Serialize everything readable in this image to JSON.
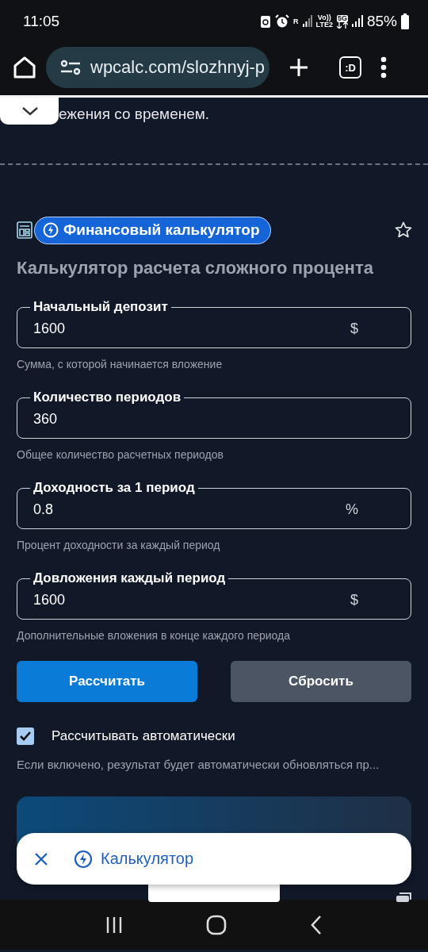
{
  "status_bar": {
    "time": "11:05",
    "indicators": [
      "R",
      "Vo))",
      "LTE2",
      "5G"
    ],
    "battery": "85%"
  },
  "browser": {
    "url": "wpcalc.com/slozhnyj-p",
    "tab_label": ":D"
  },
  "page": {
    "intro_tail": "ежения со временем.",
    "badge": "Финансовый калькулятор",
    "title": "Калькулятор расчета сложного процента",
    "fields": [
      {
        "label": "Начальный депозит",
        "value": "1600",
        "unit": "$",
        "hint": "Сумма, с которой начинается вложение"
      },
      {
        "label": "Количество периодов",
        "value": "360",
        "hint": "Общее количество расчетных периодов"
      },
      {
        "label": "Доходность за 1 период",
        "value": "0.8",
        "unit": "%",
        "hint": "Процент доходности за каждый период"
      },
      {
        "label": "Довложения каждый период",
        "value": "1600",
        "unit": "$",
        "hint": "Дополнительные вложения в конце каждого периода"
      }
    ],
    "buttons": [
      {
        "label": "Рассчитать",
        "kind": "primary"
      },
      {
        "label": "Сбросить",
        "kind": "secondary"
      }
    ],
    "auto": {
      "label": "Рассчитывать автоматически",
      "checked": true,
      "hint": "Если включено, результат будет автоматически обновляться пр..."
    }
  },
  "bottom_sheet": {
    "label": "Калькулятор"
  }
}
